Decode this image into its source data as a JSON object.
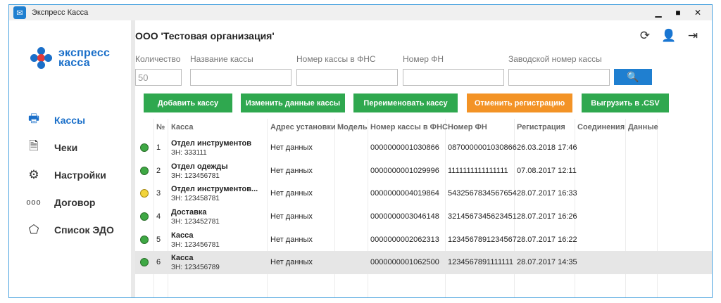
{
  "window": {
    "title": "Экспресс Касса"
  },
  "brand": {
    "line1": "экспресс",
    "line2": "касса"
  },
  "sidebar": {
    "items": [
      {
        "label": "Кассы",
        "icon": "cash-register-icon"
      },
      {
        "label": "Чеки",
        "icon": "receipt-icon"
      },
      {
        "label": "Настройки",
        "icon": "gear-icon"
      },
      {
        "label": "Договор",
        "icon": "dots-icon"
      },
      {
        "label": "Список ЭДО",
        "icon": "edo-list-icon"
      }
    ]
  },
  "header": {
    "org": "ООО 'Тестовая организация'"
  },
  "filters": {
    "count_label": "Количество",
    "count_value": "50",
    "name_label": "Название кассы",
    "fns_label": "Номер кассы в ФНС",
    "fn_label": "Номер ФН",
    "serial_label": "Заводской номер кассы"
  },
  "actions": {
    "add": "Добавить кассу",
    "edit": "Изменить данные кассы",
    "rename": "Переименовать кассу",
    "cancel_reg": "Отменить регистрацию",
    "export": "Выгрузить в .CSV"
  },
  "table": {
    "headers": {
      "num": "№",
      "kassa": "Касса",
      "address": "Адрес установки",
      "model": "Модель",
      "fns": "Номер кассы в ФНС",
      "fn": "Номер ФН",
      "reg": "Регистрация",
      "conn": "Соединения",
      "data": "Данные"
    },
    "rows": [
      {
        "num": "1",
        "name": "Отдел инструментов",
        "zn": "ЗН: 333111",
        "address": "Нет данных",
        "fns": "0000000001030866",
        "fn": "0870000001030866",
        "reg": "26.03.2018 17:46",
        "status": "green"
      },
      {
        "num": "2",
        "name": "Отдел одежды",
        "zn": "ЗН: 123456781",
        "address": "Нет данных",
        "fns": "0000000001029996",
        "fn": "1111111111111111",
        "reg": "07.08.2017 12:11",
        "status": "green"
      },
      {
        "num": "3",
        "name": "Отдел инструментов...",
        "zn": "ЗН: 123458781",
        "address": "Нет данных",
        "fns": "0000000004019864",
        "fn": "5432567834567654",
        "reg": "28.07.2017 16:33",
        "status": "yellow"
      },
      {
        "num": "4",
        "name": "Доставка",
        "zn": "ЗН: 123452781",
        "address": "Нет данных",
        "fns": "0000000003046148",
        "fn": "3214567345623451",
        "reg": "28.07.2017 16:26",
        "status": "green"
      },
      {
        "num": "5",
        "name": "Касса",
        "zn": "ЗН: 123456781",
        "address": "Нет данных",
        "fns": "0000000002062313",
        "fn": "1234567891234567",
        "reg": "28.07.2017 16:22",
        "status": "green"
      },
      {
        "num": "6",
        "name": "Касса",
        "zn": "ЗН: 123456789",
        "address": "Нет данных",
        "fns": "0000000001062500",
        "fn": "1234567891111111",
        "reg": "28.07.2017 14:35",
        "status": "green"
      }
    ]
  },
  "colors": {
    "accent": "#1f7fd0",
    "green": "#2fa84f",
    "orange": "#f39326"
  }
}
